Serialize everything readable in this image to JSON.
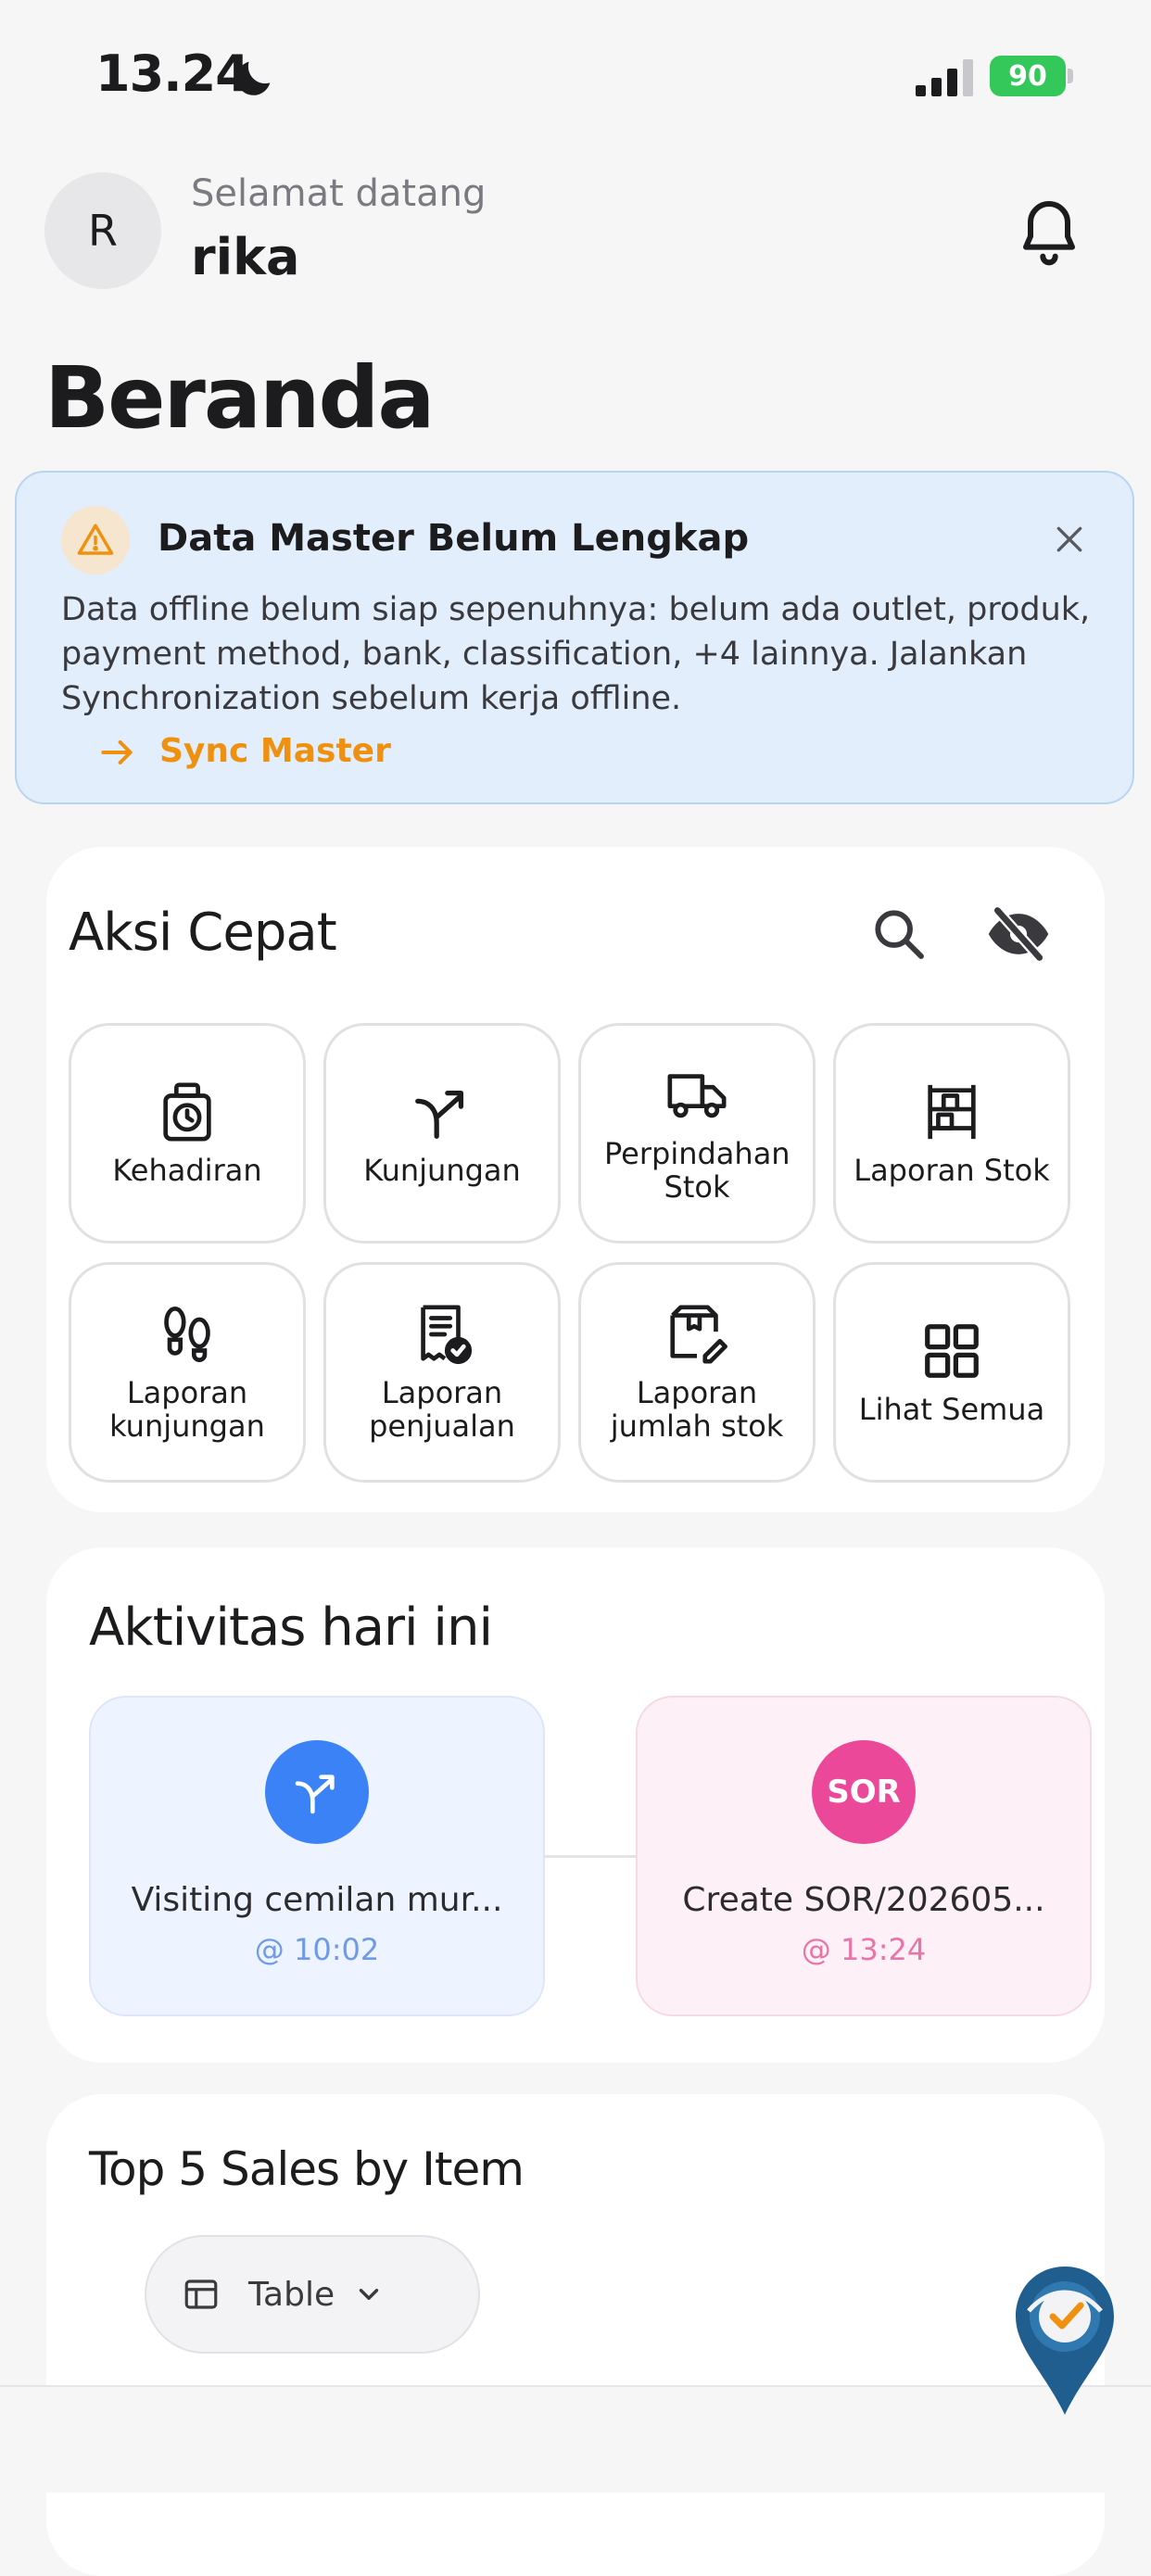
{
  "status_bar": {
    "time": "13.24",
    "battery": "90"
  },
  "header": {
    "avatar_initial": "R",
    "greeting": "Selamat datang",
    "username": "rika"
  },
  "page_title": "Beranda",
  "banner": {
    "title": "Data Master Belum Lengkap",
    "body": "Data offline belum siap sepenuhnya: belum ada outlet, produk, payment method, bank, classification, +4 lainnya. Jalankan Synchronization sebelum kerja offline.",
    "action_label": "Sync Master"
  },
  "quick_actions": {
    "title": "Aksi Cepat",
    "items": [
      {
        "label": "Kehadiran",
        "icon": "attendance-clock-icon"
      },
      {
        "label": "Kunjungan",
        "icon": "visit-arrow-icon"
      },
      {
        "label": "Perpindahan Stok",
        "icon": "truck-icon"
      },
      {
        "label": "Laporan Stok",
        "icon": "shelf-icon"
      },
      {
        "label": "Laporan kunjungan",
        "icon": "footprints-icon"
      },
      {
        "label": "Laporan penjualan",
        "icon": "receipt-check-icon"
      },
      {
        "label": "Laporan jumlah stok",
        "icon": "box-edit-icon"
      },
      {
        "label": "Lihat Semua",
        "icon": "grid-icon"
      }
    ]
  },
  "activity": {
    "title": "Aktivitas hari ini",
    "items": [
      {
        "label": "Visiting cemilan mur...",
        "time": "@ 10:02",
        "icon": "visit-arrow-icon",
        "accent": "#3b82f6"
      },
      {
        "label": "Create SOR/202605...",
        "time": "@ 13:24",
        "badge": "SOR",
        "accent": "#ec4899"
      }
    ]
  },
  "top5": {
    "title": "Top 5 Sales by Item",
    "view_selected": "Table"
  },
  "colors": {
    "accent_orange": "#f0900f",
    "banner_bg": "#e2eefb",
    "visit_blue": "#3b82f6",
    "sor_pink": "#ec4899"
  }
}
